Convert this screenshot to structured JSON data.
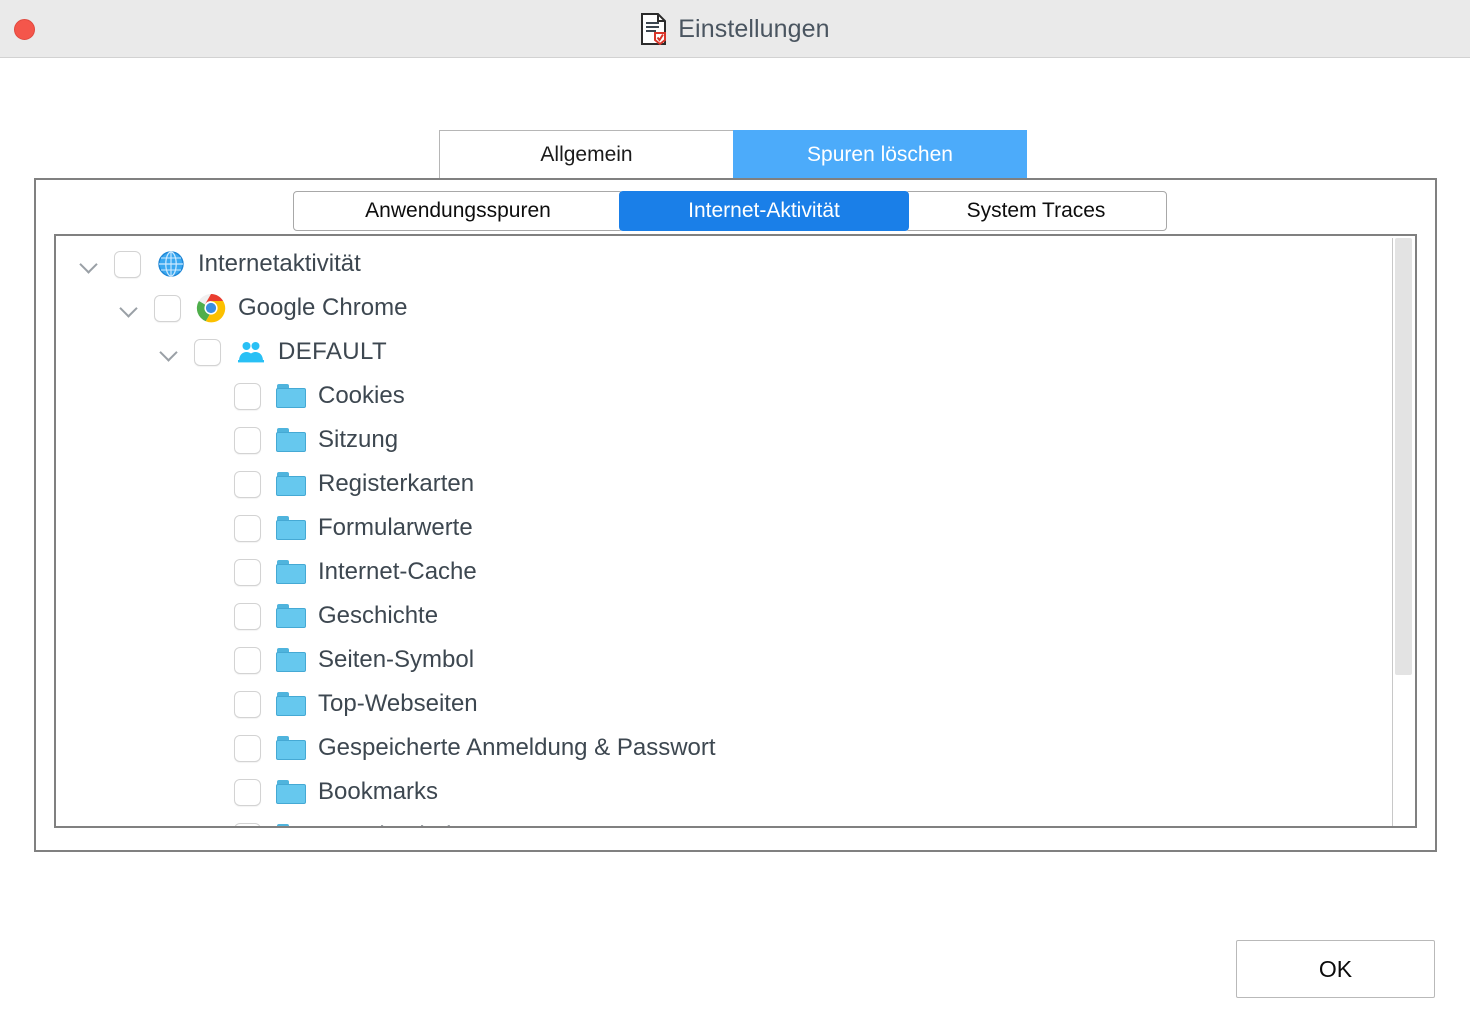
{
  "window": {
    "title": "Einstellungen",
    "title_icon": "document-shield-icon",
    "close_button_label": "",
    "titlebar_color": "#eaeaea",
    "accent_color": "#4cabfa",
    "tab_active_color": "#1a7fe8"
  },
  "outer_tabs": [
    {
      "label": "Allgemein",
      "active": false,
      "name": "tab-allgemein"
    },
    {
      "label": "Spuren löschen",
      "active": true,
      "name": "tab-spuren-loeschen"
    }
  ],
  "inner_tabs": [
    {
      "label": "Anwendungsspuren",
      "active": false,
      "name": "tab-anwendungsspuren"
    },
    {
      "label": "Internet-Aktivität",
      "active": true,
      "name": "tab-internet-aktivitaet"
    },
    {
      "label": "System Traces",
      "active": false,
      "name": "tab-system-traces"
    }
  ],
  "tree": {
    "rows": [
      {
        "label": "Internetaktivität",
        "icon": "globe-icon",
        "depth": 0,
        "expanded": true,
        "checked": false,
        "has_chevron": true
      },
      {
        "label": "Google Chrome",
        "icon": "chrome-icon",
        "depth": 1,
        "expanded": true,
        "checked": false,
        "has_chevron": true
      },
      {
        "label": "DEFAULT",
        "icon": "users-icon",
        "depth": 2,
        "expanded": true,
        "checked": false,
        "has_chevron": true
      },
      {
        "label": "Cookies",
        "icon": "folder-icon",
        "depth": 3,
        "checked": false,
        "has_chevron": false
      },
      {
        "label": "Sitzung",
        "icon": "folder-icon",
        "depth": 3,
        "checked": false,
        "has_chevron": false
      },
      {
        "label": "Registerkarten",
        "icon": "folder-icon",
        "depth": 3,
        "checked": false,
        "has_chevron": false
      },
      {
        "label": "Formularwerte",
        "icon": "folder-icon",
        "depth": 3,
        "checked": false,
        "has_chevron": false
      },
      {
        "label": "Internet-Cache",
        "icon": "folder-icon",
        "depth": 3,
        "checked": false,
        "has_chevron": false
      },
      {
        "label": "Geschichte",
        "icon": "folder-icon",
        "depth": 3,
        "checked": false,
        "has_chevron": false
      },
      {
        "label": "Seiten-Symbol",
        "icon": "folder-icon",
        "depth": 3,
        "checked": false,
        "has_chevron": false
      },
      {
        "label": "Top-Webseiten",
        "icon": "folder-icon",
        "depth": 3,
        "checked": false,
        "has_chevron": false
      },
      {
        "label": "Gespeicherte Anmeldung & Passwort",
        "icon": "folder-icon",
        "depth": 3,
        "checked": false,
        "has_chevron": false
      },
      {
        "label": "Bookmarks",
        "icon": "folder-icon",
        "depth": 3,
        "checked": false,
        "has_chevron": false
      },
      {
        "label": "Download-Liste",
        "icon": "folder-icon",
        "depth": 3,
        "checked": false,
        "has_chevron": false
      }
    ],
    "scroll_position": "top"
  },
  "footer": {
    "ok_label": "OK"
  }
}
